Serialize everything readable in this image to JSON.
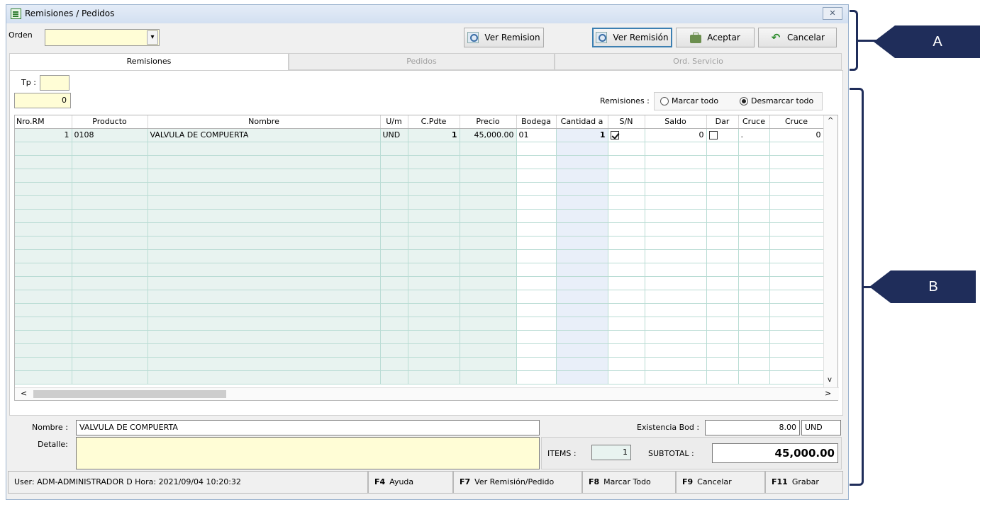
{
  "window": {
    "title": "Remisiones / Pedidos"
  },
  "toolbar": {
    "orden_label": "Orden",
    "orden_value": "",
    "ver_remision_plain": "Ver Remision",
    "ver_remision_focused": "Ver Remisión",
    "aceptar": "Aceptar",
    "cancelar": "Cancelar"
  },
  "tabs": [
    "Remisiones",
    "Pedidos",
    "Ord. Servicio"
  ],
  "filters": {
    "tp_label": "Tp :",
    "tp_value": "",
    "count_value": "0",
    "remisiones_label": "Remisiones :",
    "marcar_todo": "Marcar todo",
    "desmarcar_todo": "Desmarcar todo",
    "selected_option": "desmarcar_todo"
  },
  "grid": {
    "columns": [
      "Nro.RM",
      "Producto",
      "Nombre",
      "U/m",
      "C.Pdte",
      "Precio",
      "Bodega",
      "Cantidad a",
      "S/N",
      "Saldo",
      "Dar",
      "Cruce",
      "Cruce"
    ],
    "rows": [
      {
        "nro_rm": "1",
        "producto": "0108",
        "nombre": "VALVULA DE COMPUERTA",
        "um": "UND",
        "c_pdte": "1",
        "precio": "45,000.00",
        "bodega": "01",
        "cantidad": "1",
        "sn_checked": true,
        "saldo": "0",
        "dar_checked": false,
        "cruce1": ".",
        "cruce2": "0"
      }
    ]
  },
  "details": {
    "nombre_label": "Nombre :",
    "nombre_value": "VALVULA DE COMPUERTA",
    "detalle_label": "Detalle:",
    "detalle_value": "",
    "existencia_label": "Existencia Bod :",
    "existencia_value": "8.00",
    "existencia_unit": "UND",
    "items_label": "ITEMS :",
    "items_value": "1",
    "subtotal_label": "SUBTOTAL :",
    "subtotal_value": "45,000.00"
  },
  "statusbar": {
    "user_info": "User: ADM-ADMINISTRADOR D  Hora: 2021/09/04 10:20:32",
    "keys": [
      {
        "key": "F4",
        "label": "Ayuda"
      },
      {
        "key": "F7",
        "label": "Ver Remisión/Pedido"
      },
      {
        "key": "F8",
        "label": "Marcar Todo"
      },
      {
        "key": "F9",
        "label": "Cancelar"
      },
      {
        "key": "F11",
        "label": "Grabar"
      }
    ]
  },
  "annotations": {
    "a": "A",
    "b": "B"
  },
  "colors": {
    "yellow_field": "#fffdd6",
    "callout": "#1f2d5a",
    "grid_line": "#b9dcd4"
  },
  "icons": [
    "form-icon",
    "magnifier-icon",
    "briefcase-icon",
    "undo-icon",
    "close-icon",
    "combo-arrow-icon"
  ]
}
